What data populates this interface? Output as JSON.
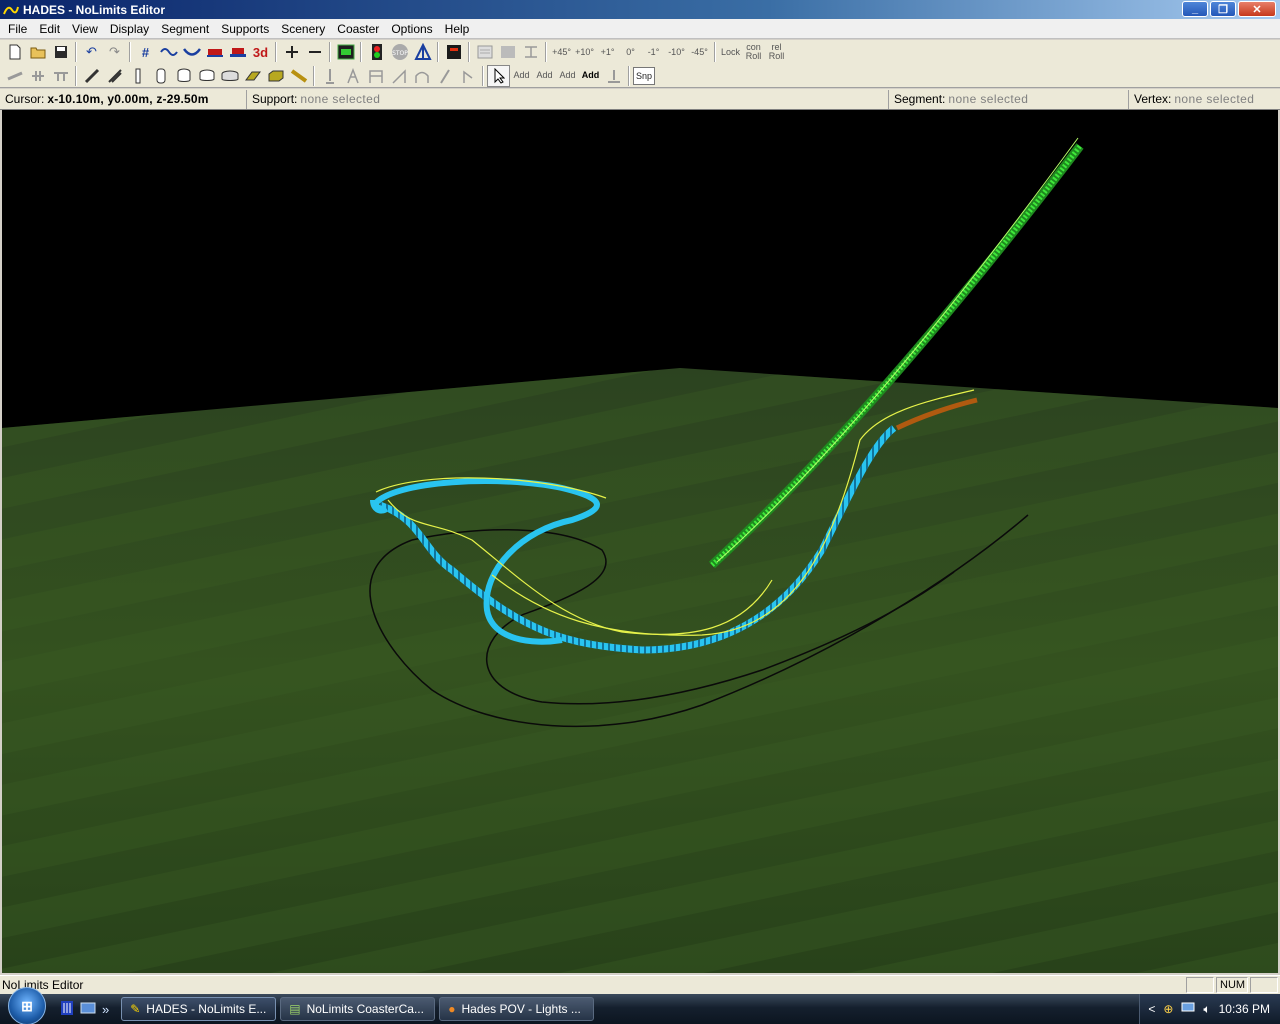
{
  "window": {
    "title": "HADES - NoLimits Editor",
    "icon": "coaster-app-icon",
    "min_glyph": "_",
    "max_glyph": "❐",
    "close_glyph": "✕"
  },
  "menu": [
    "File",
    "Edit",
    "View",
    "Display",
    "Segment",
    "Supports",
    "Scenery",
    "Coaster",
    "Options",
    "Help"
  ],
  "toolbar1_labels": {
    "plus45": "+45°",
    "plus10": "+10°",
    "plus1": "+1°",
    "zero": "0°",
    "minus1": "-1°",
    "minus10": "-10°",
    "minus45": "-45°",
    "lock": "Lock",
    "con_roll": "con Roll",
    "rel_roll": "rel Roll",
    "three_d": "3d"
  },
  "toolbar2_labels": {
    "add1": "Add",
    "add2": "Add",
    "add3": "Add",
    "add4": "Add",
    "snap": "Snp"
  },
  "info": {
    "cursor_label": "Cursor:",
    "cursor_value": "x-10.10m, y0.00m, z-29.50m",
    "support_label": "Support:",
    "support_value": "none selected",
    "segment_label": "Segment:",
    "segment_value": "none selected",
    "vertex_label": "Vertex:",
    "vertex_value": "none selected"
  },
  "viewport": {
    "sky_color": "#000000",
    "ground_color": "#2f4a1e",
    "track_colors": {
      "blue": "#29c4f0",
      "green": "#3ee83a",
      "yellow": "#e6f24a",
      "orange": "#b05a10",
      "shadow": "#0a0a0a"
    }
  },
  "statusbar": {
    "text": "NoLimits Editor",
    "num": "NUM"
  },
  "taskbar": {
    "start_glyph": "⊞",
    "tasks": [
      {
        "label": "HADES - NoLimits E...",
        "icon": "coaster-app-icon",
        "active": true
      },
      {
        "label": "NoLimits CoasterCa...",
        "icon": "notepad-icon",
        "active": false
      },
      {
        "label": "Hades POV - Lights ...",
        "icon": "firefox-icon",
        "active": false
      }
    ],
    "chevron": "<",
    "time": "10:36 PM"
  }
}
